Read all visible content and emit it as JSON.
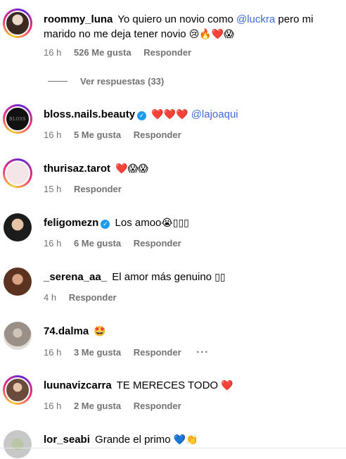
{
  "comments": [
    {
      "username": "roommy_luna",
      "text_before": "Yo quiero un novio como ",
      "mention": "@luckra",
      "text_after": " pero mi marido no me deja tener novio",
      "emojis": "😢🔥❤️😱",
      "time": "16 h",
      "likes": "526 Me gusta",
      "reply": "Responder",
      "view_replies": "Ver respuestas (33)"
    },
    {
      "username": "bloss.nails.beauty",
      "avatar_text": "BLOSS",
      "emojis": "❤️❤️❤️",
      "mention": "@lajoaqui",
      "time": "16 h",
      "likes": "5 Me gusta",
      "reply": "Responder"
    },
    {
      "username": "thurisaz.tarot",
      "emojis": "❤️😱😱",
      "time": "15 h",
      "reply": "Responder"
    },
    {
      "username": "feligomezn",
      "text": "Los amoo",
      "emojis": "😭▯▯▯",
      "time": "16 h",
      "likes": "6 Me gusta",
      "reply": "Responder"
    },
    {
      "username": "_serena_aa_",
      "text": "El amor más genuino",
      "emojis": "▯▯",
      "time": "4 h",
      "reply": "Responder"
    },
    {
      "username": "74.dalma",
      "emojis": "🤩",
      "time": "16 h",
      "likes": "3 Me gusta",
      "reply": "Responder",
      "more": "···"
    },
    {
      "username": "luunavizcarra",
      "text": "TE MERECES TODO",
      "emojis": "❤️",
      "time": "16 h",
      "likes": "2 Me gusta",
      "reply": "Responder"
    },
    {
      "username": "lor_seabi",
      "text": "Grande el primo",
      "emojis": "💙👏"
    }
  ],
  "colors": {
    "mention": "#3f6bd8",
    "meta": "#737373",
    "heart": "#e3202f",
    "verified": "#1d9bf0"
  }
}
